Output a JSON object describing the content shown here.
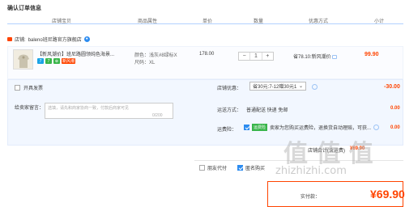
{
  "page": {
    "title": "确认订单信息"
  },
  "columns": [
    "店铺宝贝",
    "商品属性",
    "单价",
    "数量",
    "优惠方式",
    "小计"
  ],
  "shop": {
    "label": "店铺: ",
    "name": "baleno班尼路官方旗舰店"
  },
  "item": {
    "name": "【新风潮价】班尼路圆领纯色海景...",
    "badges": [
      {
        "text": "7",
        "color": "#1aa3e6"
      },
      {
        "text": "7",
        "color": "#39b54a"
      },
      {
        "text": "⊕",
        "color": "#39b54a"
      },
      {
        "text": "新风潮",
        "color": "#ff4400"
      }
    ],
    "color_label": "颜色：浅灰#8绿标X",
    "size_label": "尺码：XL",
    "price": "178.00",
    "qty_minus": "−",
    "qty": "1",
    "qty_plus": "+",
    "promo": "省78.10:新风潮价",
    "subtotal": "99.90"
  },
  "invoice": {
    "label": "开具发票"
  },
  "buyer_message": {
    "label": "给卖家留言：",
    "placeholder": "选填，请先和商家协商一致，付款后商家可见",
    "count": "0/200"
  },
  "shop_discount": {
    "label": "店铺优惠：",
    "select": "省30元:7-12赠30元1",
    "amount": "-30.00"
  },
  "delivery": {
    "label": "运送方式：",
    "text": "普通配送 快递 免邮",
    "amount": "0.00"
  },
  "shipping_insurance": {
    "label": "运费险：",
    "badge": "运费险",
    "text": "卖家为您购买运费险，退换货自动理赔，可获...",
    "amount": "0.00"
  },
  "store_total": {
    "label": "店铺合计(含运费)",
    "amount": "¥69.90"
  },
  "footer": {
    "friend_pay": "朋友代付",
    "anonymous": "匿名购买"
  },
  "payment": {
    "label": "实付款：",
    "amount": "¥69.90"
  },
  "watermark": {
    "main": "值 值 值",
    "site": "zhizhizhi.com"
  },
  "colors": {
    "accent": "#ff4400",
    "blue": "#2d8cf0",
    "header_line": "#b2d1ff"
  }
}
